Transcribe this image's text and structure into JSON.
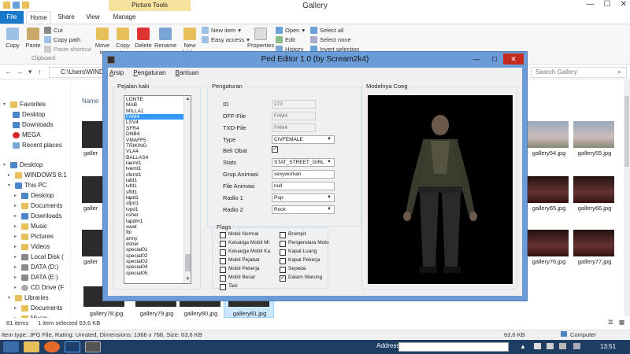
{
  "explorer": {
    "window_title": "Gallery",
    "picture_tools": "Picture Tools",
    "tabs": [
      "File",
      "Home",
      "Share",
      "View",
      "Manage"
    ],
    "ribbon": {
      "copy": "Copy",
      "paste": "Paste",
      "cut": "Cut",
      "copy_path": "Copy path",
      "paste_shortcut": "Paste shortcut",
      "clipboard_group": "Clipboard",
      "move_to": "Move to",
      "copy_to": "Copy to",
      "delete": "Delete",
      "rename": "Rename",
      "new_folder": "New folder",
      "new_item": "New item",
      "easy_access": "Easy access",
      "properties": "Properties",
      "open": "Open",
      "edit": "Edit",
      "history": "History",
      "select_all": "Select all",
      "select_none": "Select none",
      "invert_selection": "Invert selection"
    },
    "address": "C:\\Users\\WINDO",
    "search_placeholder": "Search Gallery",
    "column_name": "Name",
    "nav": {
      "favorites": "Favorites",
      "desktop": "Desktop",
      "downloads": "Downloads",
      "mega": "MEGA",
      "recent_places": "Recent places",
      "desktop2": "Desktop",
      "windows81": "WINDOWS 8.1",
      "this_pc": "This PC",
      "pc_desktop": "Desktop",
      "documents": "Documents",
      "pc_downloads": "Downloads",
      "music": "Music",
      "pictures": "Pictures",
      "videos": "Videos",
      "local_disk": "Local Disk (",
      "data_d": "DATA (D:)",
      "data_e": "DATA (E:)",
      "cd_drive": "CD Drive (F",
      "libraries": "Libraries",
      "lib_documents": "Documents",
      "lib_music": "Music"
    },
    "files_left": [
      "galler",
      "galler",
      "galler"
    ],
    "files_right": [
      "gallery54.jpg",
      "gallery55.jpg",
      "gallery65.jpg",
      "gallery66.jpg",
      "gallery76.jpg",
      "gallery77.jpg"
    ],
    "files_bottom": [
      "gallery78.jpg",
      "gallery79.jpg",
      "gallery80.jpg",
      "gallery81.jpg"
    ],
    "status": {
      "items": "81 items",
      "selected": "1 item selected  63,6 KB",
      "detail": "Item type: JPG File, Rating: Unrated, Dimensions: 1366 x 768, Size: 63,6 KB",
      "size": "63,6 KB",
      "computer": "Computer"
    }
  },
  "taskbar": {
    "address_label": "Address",
    "clock": "13:51"
  },
  "ped_editor": {
    "title": "Ped Editor 1.0 (by Scream2k4)",
    "menu": [
      "Arsip",
      "Pengaturan",
      "Bantuan"
    ],
    "group_ped": "Pejalan kaki",
    "group_settings": "Pengaturan",
    "group_model": "Modelnya Coeg",
    "group_flags": "Flags",
    "peds": [
      "LONTE",
      "MAB",
      "MILLA1",
      "FAM4",
      "LSV4",
      "SFR4",
      "DNB4",
      "VMAFF5",
      "TRIKING",
      "VLA4",
      "BALLAS4",
      "laemt1",
      "lvemt1",
      "sfemt1",
      "lafd1",
      "lvfd1",
      "sffd1",
      "lapd1",
      "sfpd1",
      "lvpd1",
      "csher",
      "lapdm1",
      "swat",
      "fbi",
      "army",
      "dsher",
      "special01",
      "special02",
      "special03",
      "special04",
      "special05"
    ],
    "selected_ped": "FAM4",
    "fields": {
      "id_label": "ID",
      "id_value": "273",
      "dff_label": "DFF-File",
      "dff_value": "FAM4",
      "txd_label": "TXD-File",
      "txd_value": "FAM4",
      "type_label": "Type",
      "type_value": "CIVFEMALE",
      "beli_obat_label": "Beli Obat",
      "stats_label": "Stats",
      "stats_value": "STAT_STREET_GIRL",
      "grup_animasi_label": "Grup Animasi",
      "grup_animasi_value": "sexywoman",
      "file_animasi_label": "File Animasi",
      "file_animasi_value": "null",
      "radio1_label": "Radio 1",
      "radio1_value": "Pop",
      "radio2_label": "Radio 2",
      "radio2_value": "Rock"
    },
    "flags_left": [
      "Mobil Normal",
      "Keluarga Mobil Mi",
      "Keluarga Mobil Ka",
      "Mobil Pejabat",
      "Mobil Pekerja",
      "Mobil Besar",
      "Taxi"
    ],
    "flags_right": [
      "Brompit",
      "Pengendara Moto",
      "Kapal Luang",
      "Kapal Pekerja",
      "Sepeda",
      "Dalam Warung"
    ],
    "flags_right_checked": [
      false,
      false,
      false,
      false,
      false,
      true
    ]
  }
}
